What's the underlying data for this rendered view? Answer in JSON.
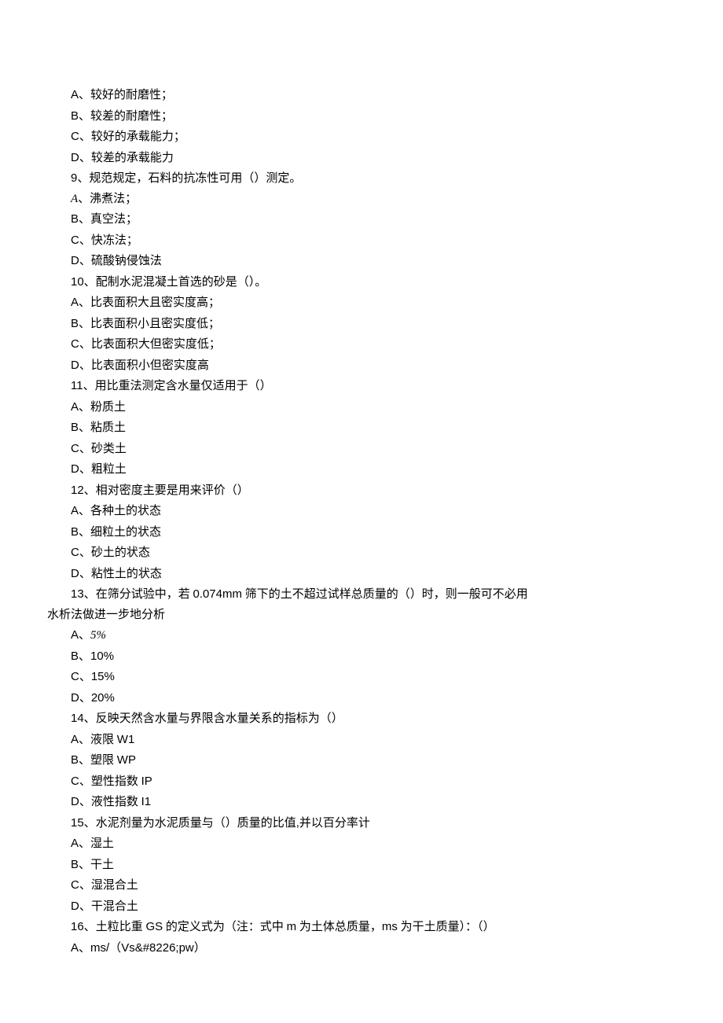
{
  "lines": [
    {
      "cls": "line",
      "spans": [
        {
          "t": "A、较好的耐磨性；",
          "c": "arial"
        }
      ]
    },
    {
      "cls": "line",
      "spans": [
        {
          "t": "B、较差的耐磨性；",
          "c": "arial"
        }
      ]
    },
    {
      "cls": "line",
      "spans": [
        {
          "t": "C、较好的承载能力；",
          "c": "arial"
        }
      ]
    },
    {
      "cls": "line",
      "spans": [
        {
          "t": "D、较差的承载能力",
          "c": "arial"
        }
      ]
    },
    {
      "cls": "line",
      "spans": [
        {
          "t": "9、",
          "c": "arial"
        },
        {
          "t": "规范规定，石料的抗冻性可用（）测定。",
          "c": ""
        }
      ]
    },
    {
      "cls": "line",
      "spans": [
        {
          "t": "A",
          "c": "italic"
        },
        {
          "t": "、沸煮法；",
          "c": ""
        }
      ]
    },
    {
      "cls": "line",
      "spans": [
        {
          "t": "B、",
          "c": "arial"
        },
        {
          "t": "真空法；",
          "c": ""
        }
      ]
    },
    {
      "cls": "line",
      "spans": [
        {
          "t": "C、",
          "c": "arial"
        },
        {
          "t": "快冻法；",
          "c": ""
        }
      ]
    },
    {
      "cls": "line",
      "spans": [
        {
          "t": "D、",
          "c": "arial"
        },
        {
          "t": "硫酸钠侵蚀法",
          "c": ""
        }
      ]
    },
    {
      "cls": "line",
      "spans": [
        {
          "t": "10、",
          "c": "arial"
        },
        {
          "t": "配制水泥混凝土首选的砂是（）。",
          "c": ""
        }
      ]
    },
    {
      "cls": "line",
      "spans": [
        {
          "t": "A、",
          "c": "arial"
        },
        {
          "t": "比表面积大且密实度高；",
          "c": ""
        }
      ]
    },
    {
      "cls": "line",
      "spans": [
        {
          "t": "B、",
          "c": "arial"
        },
        {
          "t": "比表面积小且密实度低；",
          "c": ""
        }
      ]
    },
    {
      "cls": "line",
      "spans": [
        {
          "t": "C、",
          "c": "arial"
        },
        {
          "t": "比表面积大但密实度低；",
          "c": ""
        }
      ]
    },
    {
      "cls": "line",
      "spans": [
        {
          "t": "D、",
          "c": "arial"
        },
        {
          "t": "比表面积小但密实度高",
          "c": ""
        }
      ]
    },
    {
      "cls": "line",
      "spans": [
        {
          "t": "11、",
          "c": "arial"
        },
        {
          "t": "用比重法测定含水量仅适用于（）",
          "c": ""
        }
      ]
    },
    {
      "cls": "line",
      "spans": [
        {
          "t": "A、",
          "c": "arial"
        },
        {
          "t": "粉质土",
          "c": ""
        }
      ]
    },
    {
      "cls": "line",
      "spans": [
        {
          "t": "B、",
          "c": "arial"
        },
        {
          "t": "粘质土",
          "c": ""
        }
      ]
    },
    {
      "cls": "line",
      "spans": [
        {
          "t": "C、",
          "c": "arial"
        },
        {
          "t": "砂类土",
          "c": ""
        }
      ]
    },
    {
      "cls": "line",
      "spans": [
        {
          "t": "D、",
          "c": "arial"
        },
        {
          "t": "粗粒土",
          "c": ""
        }
      ]
    },
    {
      "cls": "line",
      "spans": [
        {
          "t": "12、",
          "c": "arial"
        },
        {
          "t": "相对密度主要是用来评价（）",
          "c": ""
        }
      ]
    },
    {
      "cls": "line",
      "spans": [
        {
          "t": "A、",
          "c": "arial"
        },
        {
          "t": "各种土的状态",
          "c": ""
        }
      ]
    },
    {
      "cls": "line",
      "spans": [
        {
          "t": "B、",
          "c": "arial"
        },
        {
          "t": "细粒土的状态",
          "c": ""
        }
      ]
    },
    {
      "cls": "line",
      "spans": [
        {
          "t": "C、",
          "c": "arial"
        },
        {
          "t": "砂土的状态",
          "c": ""
        }
      ]
    },
    {
      "cls": "line",
      "spans": [
        {
          "t": "D、",
          "c": "arial"
        },
        {
          "t": "粘性土的状态",
          "c": ""
        }
      ]
    },
    {
      "cls": "line",
      "spans": [
        {
          "t": "13、",
          "c": "arial"
        },
        {
          "t": "在筛分试验中，若 ",
          "c": ""
        },
        {
          "t": "0.074mm",
          "c": "arial"
        },
        {
          "t": " 筛下的土不超过试样总质量的（）时，则一般可不必用",
          "c": ""
        }
      ]
    },
    {
      "cls": "line-noindent",
      "spans": [
        {
          "t": "水析法做进一步地分析",
          "c": ""
        }
      ]
    },
    {
      "cls": "line",
      "spans": [
        {
          "t": "A、",
          "c": "arial"
        },
        {
          "t": "5%",
          "c": "italic"
        }
      ]
    },
    {
      "cls": "line",
      "spans": [
        {
          "t": "B、10%",
          "c": "arial"
        }
      ]
    },
    {
      "cls": "line",
      "spans": [
        {
          "t": "C、15%",
          "c": "arial"
        }
      ]
    },
    {
      "cls": "line",
      "spans": [
        {
          "t": "D、20%",
          "c": "arial"
        }
      ]
    },
    {
      "cls": "line",
      "spans": [
        {
          "t": "14、",
          "c": "arial"
        },
        {
          "t": "反映天然含水量与界限含水量关系的指标为（）",
          "c": ""
        }
      ]
    },
    {
      "cls": "line",
      "spans": [
        {
          "t": "A、",
          "c": "arial"
        },
        {
          "t": "液限 ",
          "c": ""
        },
        {
          "t": "W1",
          "c": "arial"
        }
      ]
    },
    {
      "cls": "line",
      "spans": [
        {
          "t": "B、",
          "c": "arial"
        },
        {
          "t": "塑限 ",
          "c": ""
        },
        {
          "t": "WP",
          "c": "arial"
        }
      ]
    },
    {
      "cls": "line",
      "spans": [
        {
          "t": "C、",
          "c": "arial"
        },
        {
          "t": "塑性指数 ",
          "c": ""
        },
        {
          "t": "IP",
          "c": "arial"
        }
      ]
    },
    {
      "cls": "line",
      "spans": [
        {
          "t": "D、",
          "c": "arial"
        },
        {
          "t": "液性指数 ",
          "c": ""
        },
        {
          "t": "I1",
          "c": "arial"
        }
      ]
    },
    {
      "cls": "line",
      "spans": [
        {
          "t": "15、",
          "c": "arial"
        },
        {
          "t": "水泥剂量为水泥质量与（）质量的比值",
          "c": ""
        },
        {
          "t": ",",
          "c": "arial"
        },
        {
          "t": "并以百分率计",
          "c": ""
        }
      ]
    },
    {
      "cls": "line",
      "spans": [
        {
          "t": "A、",
          "c": "arial"
        },
        {
          "t": "湿土",
          "c": ""
        }
      ]
    },
    {
      "cls": "line",
      "spans": [
        {
          "t": "B、",
          "c": "arial"
        },
        {
          "t": "干土",
          "c": ""
        }
      ]
    },
    {
      "cls": "line",
      "spans": [
        {
          "t": "C、",
          "c": "arial"
        },
        {
          "t": "湿混合土",
          "c": ""
        }
      ]
    },
    {
      "cls": "line",
      "spans": [
        {
          "t": "D、",
          "c": "arial"
        },
        {
          "t": "干混合土",
          "c": ""
        }
      ]
    },
    {
      "cls": "line",
      "spans": [
        {
          "t": "16、",
          "c": "arial"
        },
        {
          "t": "土粒比重 ",
          "c": ""
        },
        {
          "t": "GS",
          "c": "arial"
        },
        {
          "t": " 的定义式为（注：式中 ",
          "c": ""
        },
        {
          "t": "m",
          "c": "arial"
        },
        {
          "t": " 为土体总质量，",
          "c": ""
        },
        {
          "t": "ms",
          "c": "arial"
        },
        {
          "t": " 为干土质量）：（）",
          "c": ""
        }
      ]
    },
    {
      "cls": "line",
      "spans": [
        {
          "t": "A、ms/",
          "c": "arial"
        },
        {
          "t": "（",
          "c": ""
        },
        {
          "t": "Vs&#8226;pw",
          "c": "arial"
        },
        {
          "t": "）",
          "c": ""
        }
      ]
    }
  ]
}
